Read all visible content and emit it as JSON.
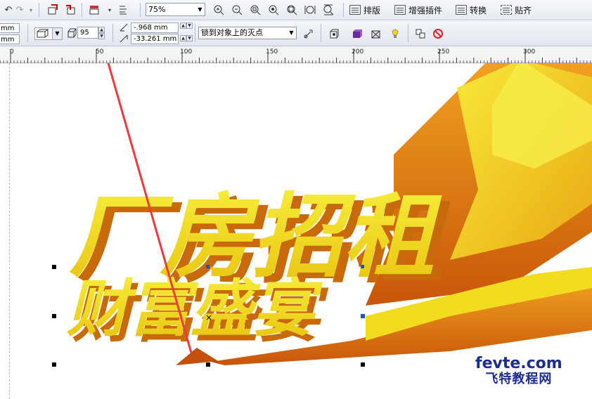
{
  "toolbar": {
    "zoom_value": "75%",
    "menu_arrange": "排版",
    "menu_plugins": "增强插件",
    "menu_convert": "转换",
    "menu_align": "贴齐"
  },
  "property_bar": {
    "unit_top": "mm",
    "unit_bottom": "mm",
    "rotation_value": "95",
    "x_value": "-.968 mm",
    "y_value": "-33.261 mm",
    "snap_option": "锁到对象上的灭点"
  },
  "ruler": {
    "labels": [
      "0",
      "50",
      "100",
      "150",
      "200",
      "250",
      "300"
    ]
  },
  "artwork": {
    "headline": "厂房招租",
    "subline": "财富盛宴"
  },
  "watermark": {
    "top": "fevte.com",
    "bottom": "飞特教程网"
  },
  "colors": {
    "art_yellow": "#f4e21a",
    "art_orange": "#e07a10",
    "arrow_red": "#f03a3a",
    "handle_blue": "#1e4fd8"
  }
}
